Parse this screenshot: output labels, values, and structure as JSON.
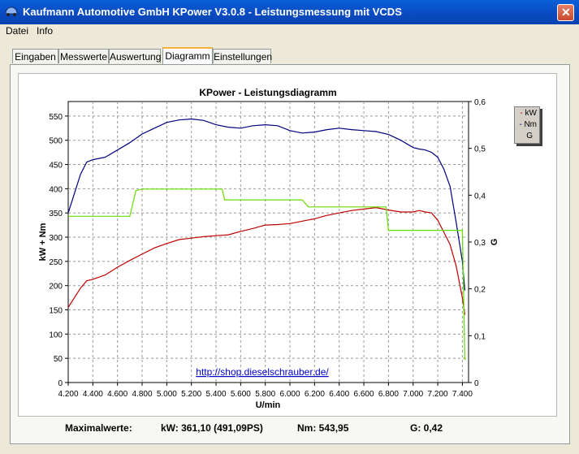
{
  "window": {
    "title": "Kaufmann Automotive GmbH  KPower V3.0.8 - Leistungsmessung mit VCDS",
    "close_symbol": "✕"
  },
  "menu": [
    "Datei",
    "Info"
  ],
  "tabs": [
    "Eingaben",
    "Messwerte",
    "Auswertung",
    "Diagramm",
    "Einstellungen"
  ],
  "active_tab": "Diagramm",
  "legend": [
    "kW",
    "Nm",
    "G"
  ],
  "link_text": "http://shop.dieselschrauber.de/",
  "footer": {
    "label": "Maximalwerte:",
    "kw": "kW: 361,10 (491,09PS)",
    "nm": "Nm: 543,95",
    "g": "G: 0,42"
  },
  "colors": {
    "kw": "#c00000",
    "nm": "#000080",
    "g": "#66dd00"
  },
  "chart_data": {
    "type": "line",
    "title": "KPower - Leistungsdiagramm",
    "xlabel": "U/min",
    "ylabel": "kW + Nm",
    "y2label": "G",
    "xlim": [
      4200,
      7450
    ],
    "ylim": [
      0,
      580
    ],
    "y2lim": [
      0,
      0.6
    ],
    "grid": true,
    "x_ticks": [
      "4.200",
      "4.400",
      "4.600",
      "4.800",
      "5.000",
      "5.200",
      "5.400",
      "5.600",
      "5.800",
      "6.000",
      "6.200",
      "6.400",
      "6.600",
      "6.800",
      "7.000",
      "7.200",
      "7.400"
    ],
    "y_ticks": [
      "0",
      "50",
      "100",
      "150",
      "200",
      "250",
      "300",
      "350",
      "400",
      "450",
      "500",
      "550"
    ],
    "y2_ticks": [
      "0",
      "0,1",
      "0,2",
      "0,3",
      "0,4",
      "0,5",
      "0,6"
    ],
    "legend_position": "right",
    "series": [
      {
        "name": "Nm",
        "axis": "left",
        "x": [
          4200,
          4250,
          4300,
          4350,
          4400,
          4500,
          4600,
          4700,
          4800,
          4900,
          5000,
          5100,
          5200,
          5300,
          5400,
          5500,
          5600,
          5700,
          5800,
          5900,
          6000,
          6100,
          6200,
          6300,
          6400,
          6500,
          6600,
          6700,
          6800,
          6900,
          7000,
          7050,
          7100,
          7150,
          7200,
          7250,
          7300,
          7350,
          7400,
          7420
        ],
        "y": [
          350,
          390,
          430,
          455,
          460,
          465,
          480,
          495,
          513,
          525,
          537,
          542,
          544,
          541,
          532,
          527,
          525,
          530,
          532,
          530,
          520,
          515,
          517,
          522,
          525,
          522,
          520,
          518,
          512,
          500,
          485,
          482,
          480,
          475,
          465,
          440,
          405,
          330,
          250,
          190
        ]
      },
      {
        "name": "kW",
        "axis": "left",
        "x": [
          4200,
          4250,
          4300,
          4350,
          4400,
          4500,
          4600,
          4700,
          4800,
          4900,
          5000,
          5100,
          5200,
          5300,
          5400,
          5500,
          5600,
          5700,
          5800,
          5900,
          6000,
          6100,
          6200,
          6300,
          6400,
          6500,
          6600,
          6700,
          6800,
          6900,
          7000,
          7050,
          7100,
          7150,
          7200,
          7250,
          7300,
          7350,
          7400,
          7420
        ],
        "y": [
          155,
          175,
          195,
          210,
          213,
          222,
          238,
          252,
          265,
          278,
          287,
          295,
          298,
          301,
          303,
          305,
          312,
          318,
          325,
          326,
          328,
          333,
          338,
          345,
          350,
          355,
          358,
          361,
          356,
          352,
          352,
          355,
          352,
          350,
          335,
          310,
          285,
          240,
          175,
          140
        ]
      },
      {
        "name": "G",
        "axis": "right",
        "x": [
          4200,
          4700,
          4750,
          4800,
          5100,
          5450,
          5470,
          5900,
          6100,
          6150,
          6600,
          6780,
          6800,
          7000,
          7400,
          7420,
          7430
        ],
        "y": [
          0.355,
          0.355,
          0.41,
          0.413,
          0.413,
          0.413,
          0.39,
          0.39,
          0.39,
          0.375,
          0.375,
          0.375,
          0.325,
          0.325,
          0.325,
          0.05,
          0.05
        ]
      }
    ]
  }
}
